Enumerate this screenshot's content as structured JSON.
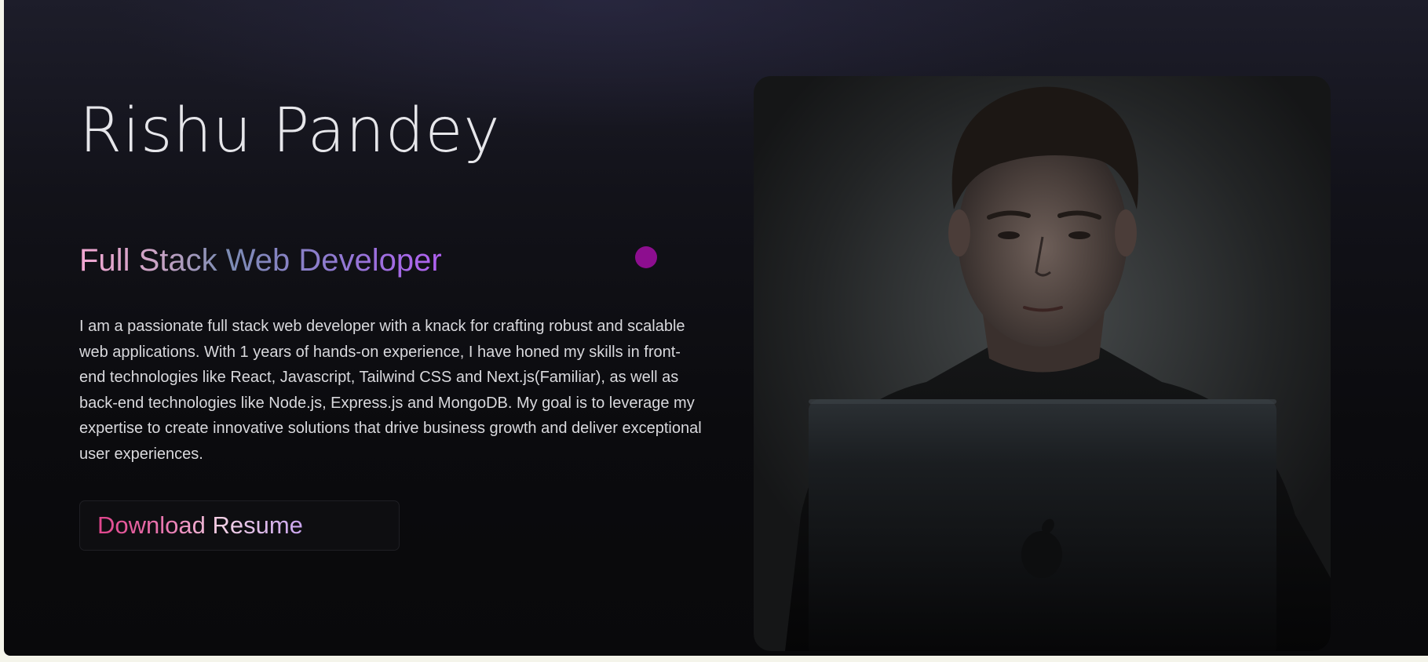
{
  "hero": {
    "name": "Rishu Pandey",
    "role": "Full Stack Web Developer",
    "bio": "I am a passionate full stack web developer with a knack for crafting robust and scalable web applications. With 1 years of hands-on experience, I have honed my skills in front-end technologies like React, Javascript, Tailwind CSS and Next.js(Familiar), as well as back-end technologies like Node.js, Express.js and MongoDB. My goal is to leverage my expertise to create innovative solutions that drive business growth and deliver exceptional user experiences.",
    "resume_button_label": "Download Resume",
    "photo_icon": "developer-photo",
    "accent_dot_color": "#8d0e8f"
  },
  "colors": {
    "background": "#0b0b0e",
    "name_text": "#e6e6ea",
    "body_text": "#d9d9dd",
    "accent_pink": "#e0448c",
    "accent_purple": "#b160f2"
  }
}
